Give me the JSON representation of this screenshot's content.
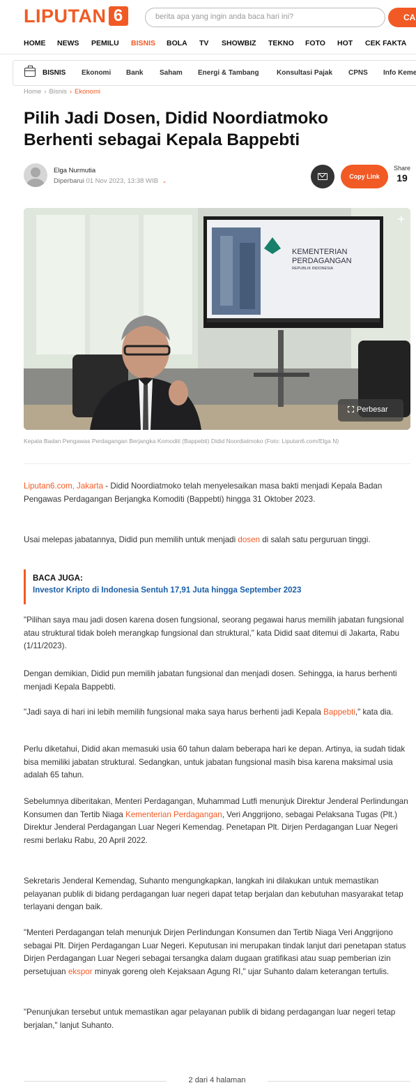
{
  "header": {
    "logo_text": "LIPUTAN",
    "logo_number": "6",
    "search_placeholder": "berita apa yang ingin anda baca hari ini?",
    "search_button": "CA"
  },
  "main_nav": [
    "HOME",
    "NEWS",
    "PEMILU",
    "BISNIS",
    "BOLA",
    "TV",
    "SHOWBIZ",
    "TEKNO",
    "FOTO",
    "HOT",
    "CEK FAKTA"
  ],
  "main_nav_active": "BISNIS",
  "sub_nav": {
    "category": "BISNIS",
    "items": [
      "Ekonomi",
      "Bank",
      "Saham",
      "Energi & Tambang",
      "Konsultasi Pajak",
      "CPNS",
      "Info Keme"
    ]
  },
  "breadcrumb": [
    "Home",
    "Bisnis",
    "Ekonomi"
  ],
  "article": {
    "title": "Pilih Jadi Dosen, Didid Noordiatmoko Berhenti sebagai Kepala Bappebti",
    "author": "Elga Nurmutia",
    "updated_label": "Diperbarui",
    "updated_date": "01 Nov 2023, 13:38 WIB",
    "copy_link": "Copy Link",
    "share_label": "Share",
    "share_count": "19",
    "image_enlarge": "Perbesar",
    "image_plus": "+",
    "caption": "Kepala Badan Pengawas Perdagangan Berjangka Komoditi (Bappebti) Didid Noordiatmoko (Foto: Liputan6.com/Elga N)",
    "dateline": "Liputan6.com, Jakarta",
    "p1": " - Didid Noordiatmoko telah menyelesaikan masa bakti menjadi Kepala Badan Pengawas Perdagangan Berjangka Komoditi (Bappebti) hingga 31 Oktober 2023.",
    "p2_a": "Usai melepas jabatannya, Didid pun memilih untuk menjadi ",
    "p2_link": "dosen",
    "p2_b": " di salah satu perguruan tinggi.",
    "baca_juga_label": "BACA JUGA:",
    "baca_juga_link": "Investor Kripto di Indonesia Sentuh 17,91 Juta hingga September 2023",
    "p3": "\"Pilihan saya mau jadi dosen karena dosen fungsional, seorang pegawai harus memilih jabatan fungsional atau struktural tidak boleh merangkap fungsional dan struktural,\" kata Didid saat ditemui di Jakarta, Rabu (1/11/2023).",
    "p4": "Dengan demikian, Didid pun memilih jabatan fungsional dan menjadi dosen. Sehingga, ia harus berhenti menjadi Kepala Bappebti.",
    "p5_a": "\"Jadi saya di hari ini lebih memilih fungsional maka saya harus berhenti jadi Kepala ",
    "p5_link": "Bappebti",
    "p5_b": ",\" kata dia.",
    "p6": "Perlu diketahui, Didid akan memasuki usia 60 tahun dalam beberapa hari ke depan. Artinya, ia sudah tidak bisa memiliki jabatan struktural. Sedangkan, untuk jabatan fungsional masih bisa karena maksimal usia adalah 65 tahun.",
    "p7_a": "Sebelumnya diberitakan, Menteri Perdagangan, Muhammad Lutfi menunjuk Direktur Jenderal Perlindungan Konsumen dan Tertib Niaga ",
    "p7_link": "Kementerian Perdagangan",
    "p7_b": ", Veri Anggrijono, sebagai Pelaksana Tugas (Plt.) Direktur Jenderal Perdagangan Luar Negeri Kemendag. Penetapan Plt. Dirjen Perdagangan Luar Negeri resmi berlaku Rabu, 20 April 2022.",
    "p8": "Sekretaris Jenderal Kemendag, Suhanto mengungkapkan, langkah ini dilakukan untuk memastikan pelayanan publik di bidang perdagangan luar negeri dapat tetap berjalan dan kebutuhan masyarakat tetap terlayani dengan baik.",
    "p9_a": "\"Menteri Perdagangan telah menunjuk Dirjen Perlindungan Konsumen dan Tertib Niaga Veri Anggrijono sebagai Plt. Dirjen Perdagangan Luar Negeri. Keputusan ini merupakan tindak lanjut dari penetapan status Dirjen Perdagangan Luar Negeri sebagai tersangka dalam dugaan gratifikasi atau suap pemberian izin persetujuan ",
    "p9_link": "ekspor",
    "p9_b": " minyak goreng oleh Kejaksaan Agung RI,\" ujar Suhanto dalam keterangan tertulis.",
    "p10": "\"Penunjukan tersebut untuk memastikan agar pelayanan publik di bidang perdagangan luar negeri tetap berjalan,\" lanjut Suhanto.",
    "pagination": "2 dari 4 halaman"
  },
  "photo_screen": {
    "line1": "KEMENTERIAN",
    "line2": "PERDAGANGAN",
    "line3": "REPUBLIK INDONESIA"
  },
  "colors": {
    "brand": "#f15a24",
    "link_blue": "#1a5fa8"
  }
}
